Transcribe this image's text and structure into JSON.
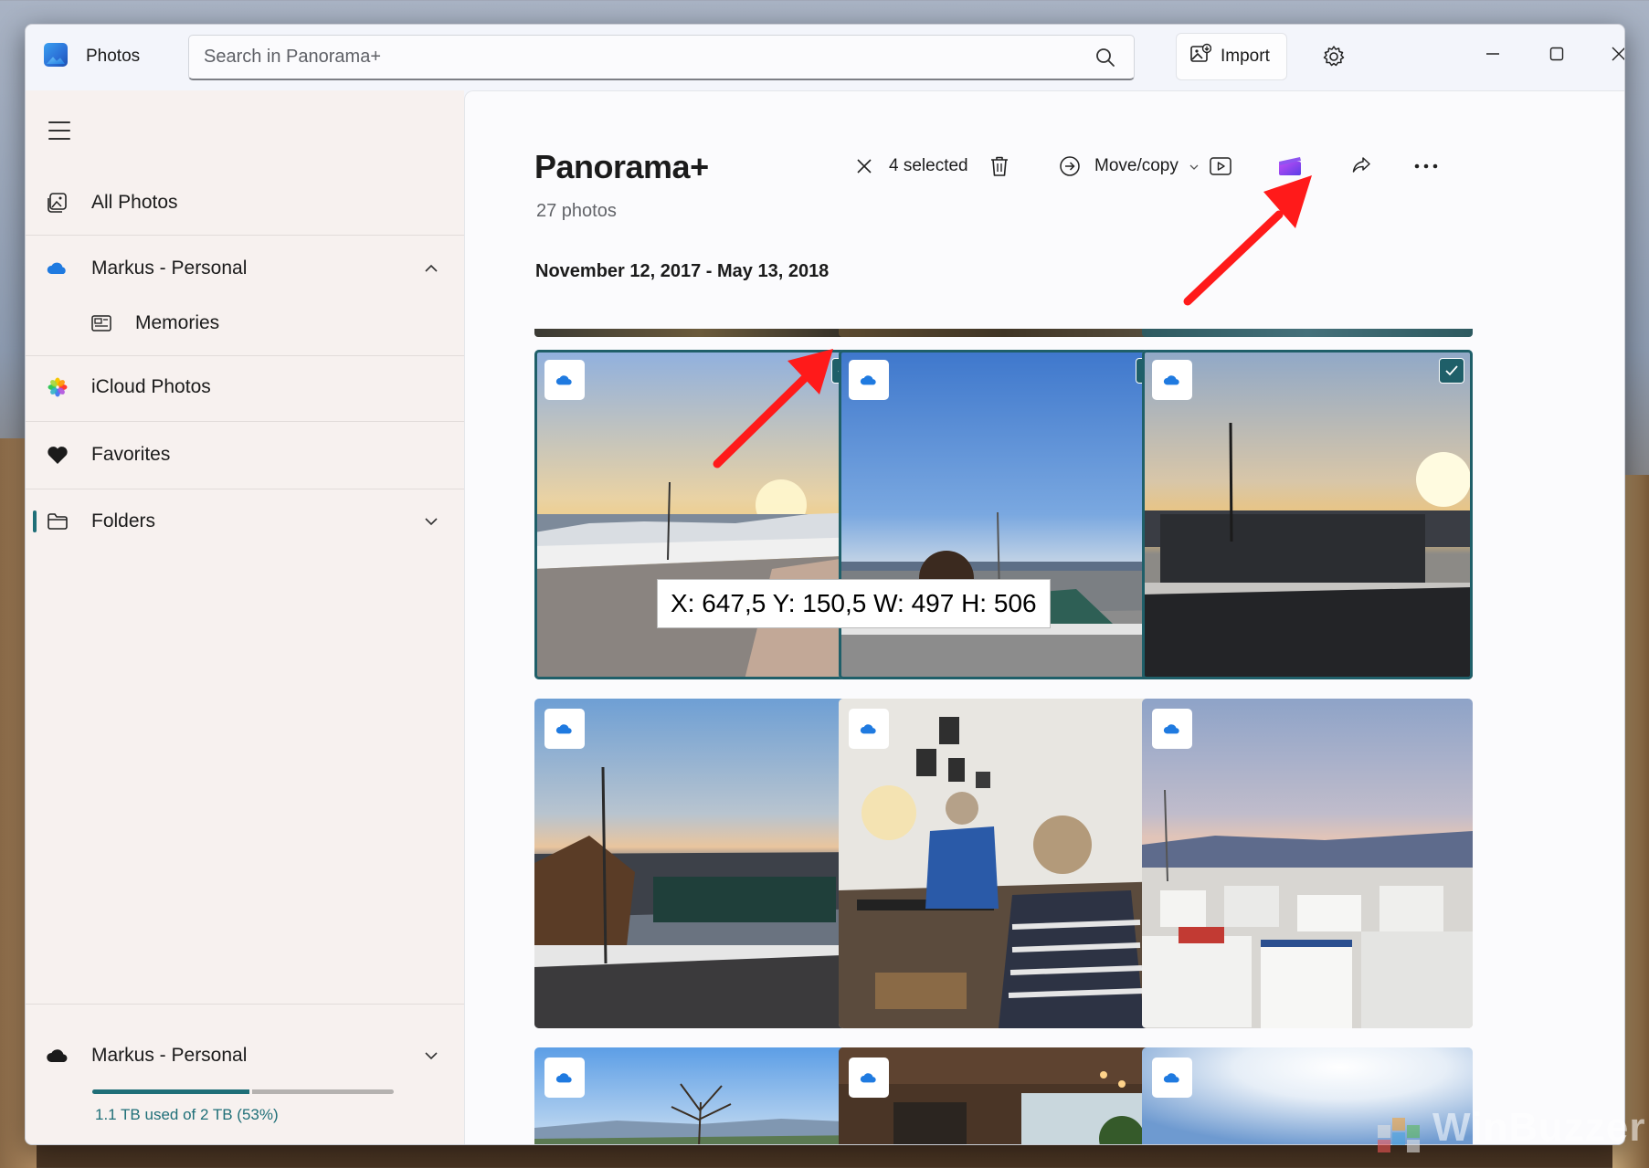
{
  "app": {
    "title": "Photos"
  },
  "search": {
    "placeholder": "Search in Panorama+"
  },
  "header": {
    "import_label": "Import"
  },
  "sidebar": {
    "items": [
      {
        "label": "All Photos"
      },
      {
        "label": "Markus - Personal"
      },
      {
        "label": "Memories"
      },
      {
        "label": "iCloud Photos"
      },
      {
        "label": "Favorites"
      },
      {
        "label": "Folders"
      }
    ],
    "storage": {
      "account": "Markus - Personal",
      "usage_text": "1.1 TB used of 2 TB (53%)",
      "used_fraction": 0.53
    }
  },
  "main": {
    "title": "Panorama+",
    "count": "27 photos",
    "date_range": "November 12, 2017 - May 13, 2018",
    "toolbar": {
      "selected_label": "4 selected",
      "move_copy_label": "Move/copy"
    }
  },
  "overlay": {
    "coords": "X: 647,5 Y: 150,5 W: 497 H: 506"
  },
  "watermark": {
    "text": "WinBuzzer"
  },
  "colors": {
    "accent": "#1f6f78",
    "arrow": "#ff1a1a",
    "onedrive": "#1f7ae0"
  }
}
